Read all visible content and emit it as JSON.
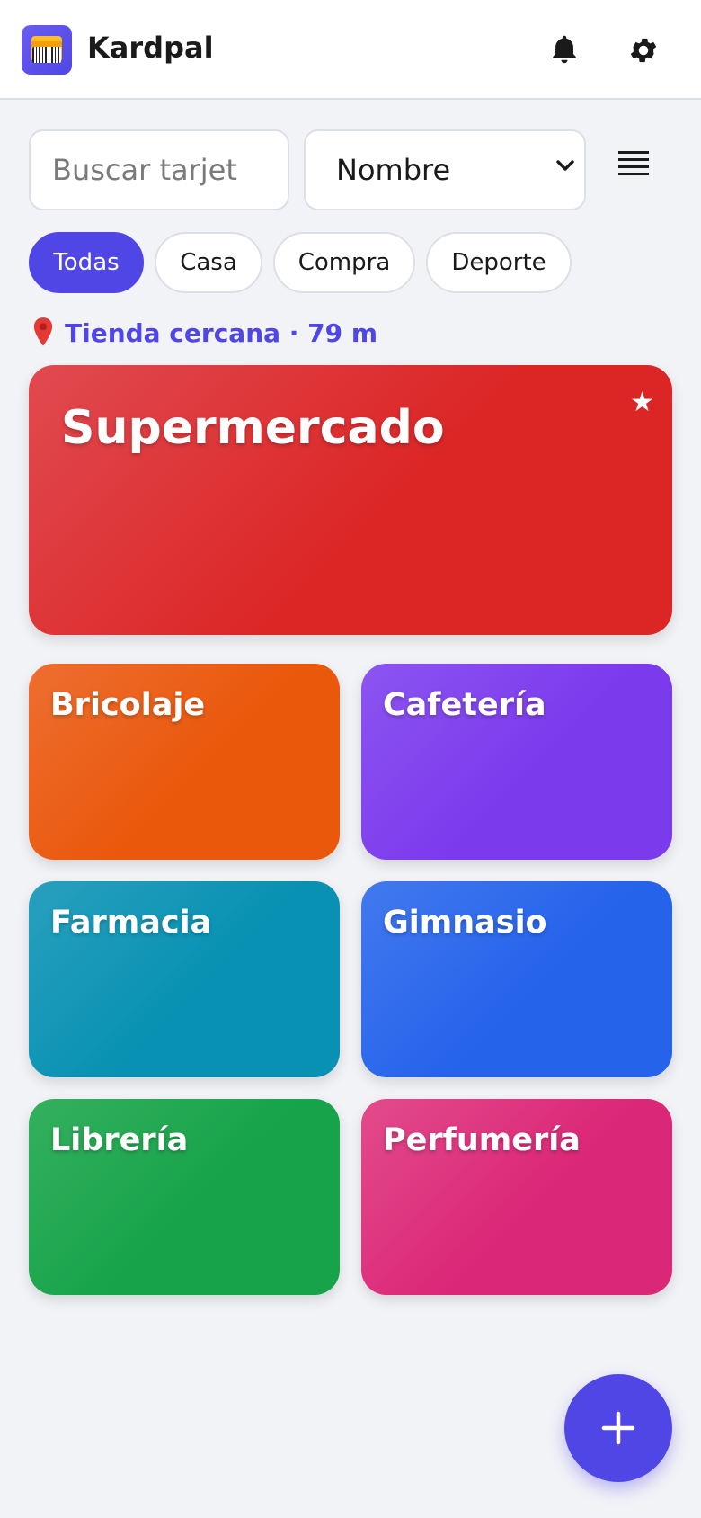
{
  "app": {
    "title": "Kardpal"
  },
  "header": {
    "icons": [
      "app-logo-icon",
      "bell-icon",
      "gear-icon"
    ]
  },
  "search": {
    "placeholder": "Buscar tarjet",
    "value": ""
  },
  "sort": {
    "selected": "Nombre"
  },
  "filters": {
    "chips": [
      {
        "label": "Todas",
        "active": true
      },
      {
        "label": "Casa",
        "active": false
      },
      {
        "label": "Compra",
        "active": false
      },
      {
        "label": "Deporte",
        "active": false
      }
    ]
  },
  "nearby": {
    "text": "Tienda cercana · 79 m",
    "icon": "pin-icon"
  },
  "featured": {
    "name": "Supermercado",
    "color": "#dc2626",
    "favorite_icon": "star-icon"
  },
  "cards": [
    {
      "name": "Bricolaje",
      "color": "#ea580c"
    },
    {
      "name": "Cafetería",
      "color": "#7c3aed"
    },
    {
      "name": "Farmacia",
      "color": "#0891b2"
    },
    {
      "name": "Gimnasio",
      "color": "#2563eb"
    },
    {
      "name": "Librería",
      "color": "#16a34a"
    },
    {
      "name": "Perfumería",
      "color": "#db2777"
    }
  ],
  "fab": {
    "icon": "plus-icon"
  },
  "colors": {
    "accent": "#4f46e5",
    "background": "#f2f3f7"
  }
}
